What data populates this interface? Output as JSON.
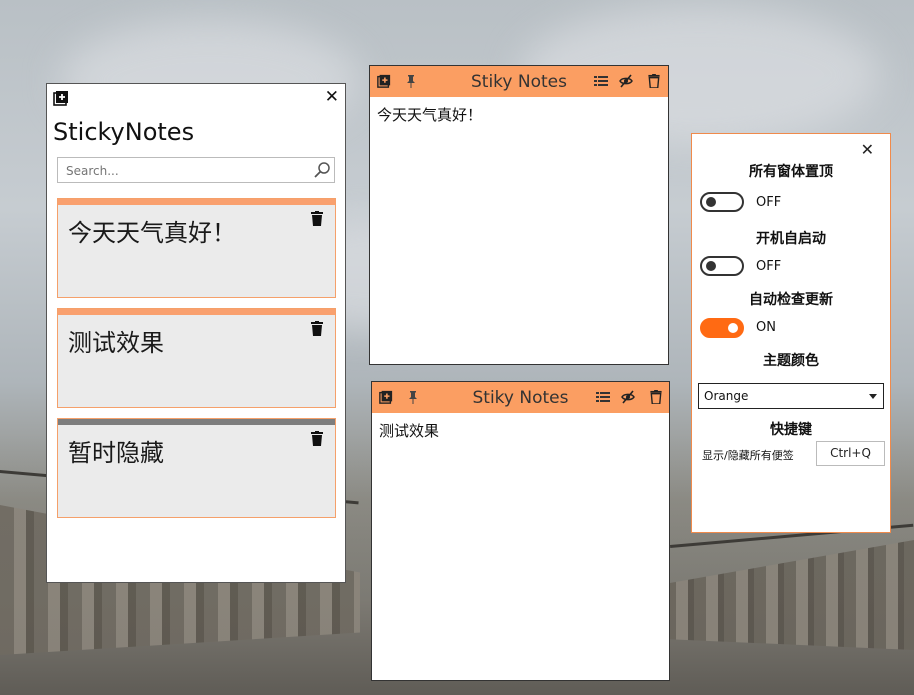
{
  "main": {
    "title": "StickyNotes",
    "close_glyph": "✕",
    "search_placeholder": "Search...",
    "notes": [
      {
        "text": "今天天气真好！",
        "bar_color": "#f9a06e"
      },
      {
        "text": "测试效果",
        "bar_color": "#f9a06e"
      },
      {
        "text": "暂时隐藏",
        "bar_color": "#7d7d7d"
      }
    ]
  },
  "note_windows": [
    {
      "title": "Stiky Notes",
      "content": "今天天气真好！",
      "header_color": "#fb9e62"
    },
    {
      "title": "Stiky Notes",
      "content": "测试效果",
      "header_color": "#fb9e62"
    }
  ],
  "settings": {
    "close_glyph": "✕",
    "always_on_top": {
      "label": "所有窗体置顶",
      "state": "OFF"
    },
    "auto_start": {
      "label": "开机自启动",
      "state": "OFF"
    },
    "auto_update": {
      "label": "自动检查更新",
      "state": "ON"
    },
    "theme": {
      "label": "主题颜色",
      "selected": "Orange"
    },
    "hotkey": {
      "label": "快捷键",
      "action": "显示/隐藏所有便签",
      "key": "Ctrl+Q"
    },
    "accent_color": "#ff6a13"
  },
  "icons": [
    "add-note-icon",
    "close-icon",
    "search-icon",
    "trash-icon",
    "pin-icon",
    "list-icon",
    "hide-icon"
  ]
}
